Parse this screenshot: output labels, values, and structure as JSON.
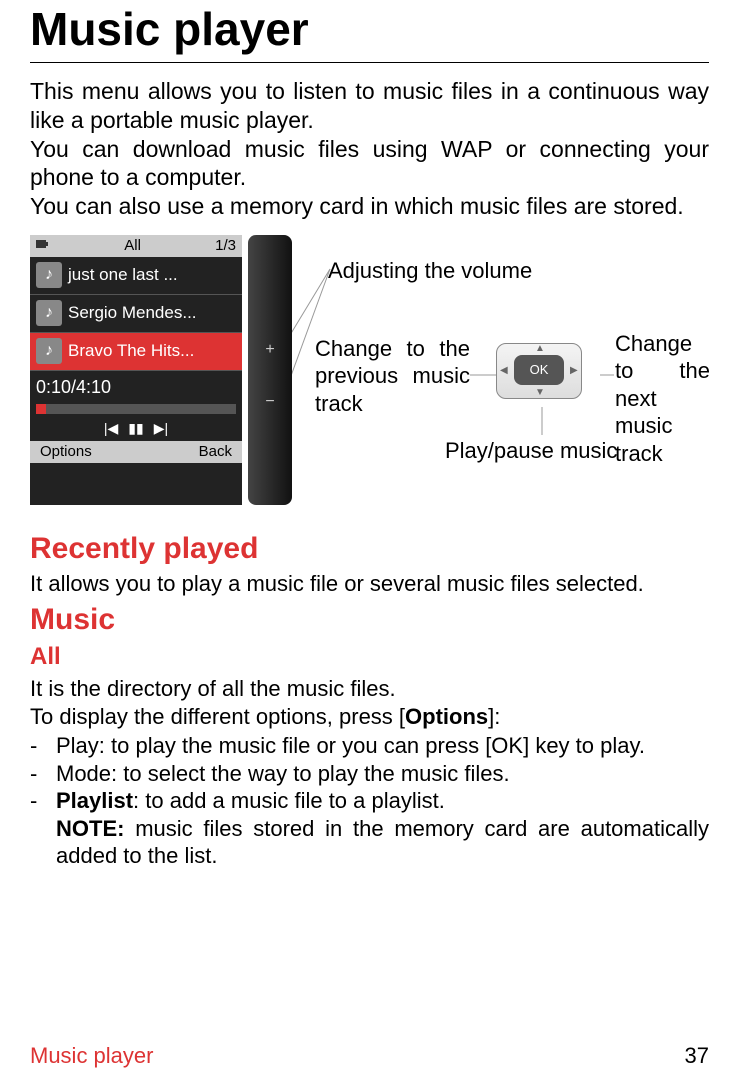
{
  "title": "Music player",
  "intro": {
    "p1": "This menu allows you to listen to music files in a continuous way like a portable music player.",
    "p2": "You can download music files using WAP or connecting your phone to a computer.",
    "p3": "You can also use a memory card in which music files are stored."
  },
  "phone": {
    "top_label": "All",
    "top_count": "1/3",
    "tracks": [
      "just one last ...",
      "Sergio Mendes...",
      "Bravo The Hits..."
    ],
    "time": "0:10/4:10",
    "soft_left": "Options",
    "soft_right": "Back"
  },
  "callouts": {
    "volume": "Adjusting the volume",
    "prev": "Change to the previous music track",
    "next": "Change to the next music track",
    "play": "Play/pause music",
    "ok_label": "OK"
  },
  "sections": {
    "recently_title": "Recently played",
    "recently_body": "It allows you to play a music file or several music files selected.",
    "music_title": "Music",
    "all_title": "All",
    "all_p1": "It is the directory of all the music files.",
    "all_p2_pre": "To display the different options, press [",
    "all_p2_bold": "Options",
    "all_p2_post": "]:",
    "opt_play": "Play: to play the music file or you can press [OK] key to play.",
    "opt_mode": "Mode: to select the way to play the music files.",
    "opt_playlist_bold": "Playlist",
    "opt_playlist_rest": ": to add a music file to a playlist.",
    "note_bold": "NOTE:",
    "note_rest": " music files stored in the memory card are automatically added to the list."
  },
  "footer": {
    "section": "Music player",
    "page": "37"
  }
}
